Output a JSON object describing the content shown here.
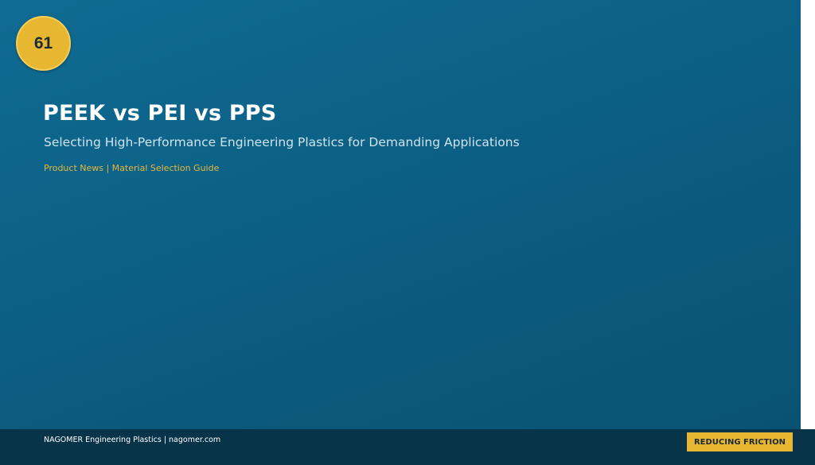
{
  "slide": {
    "page_number": "61",
    "title": "PEEK vs PEI vs PPS",
    "subtitle": "Selecting High-Performance Engineering Plastics for Demanding Applications",
    "tagline": "Product News | Material Selection Guide"
  },
  "footer": {
    "company": "NAGOMER Engineering Plastics | nagomer.com",
    "badge": "REDUCING FRICTION"
  },
  "colors": {
    "background": "#0c5f84",
    "accent": "#e7b732",
    "footer": "#08344a",
    "title": "#ffffff",
    "subtitle": "#cfe3ee"
  }
}
